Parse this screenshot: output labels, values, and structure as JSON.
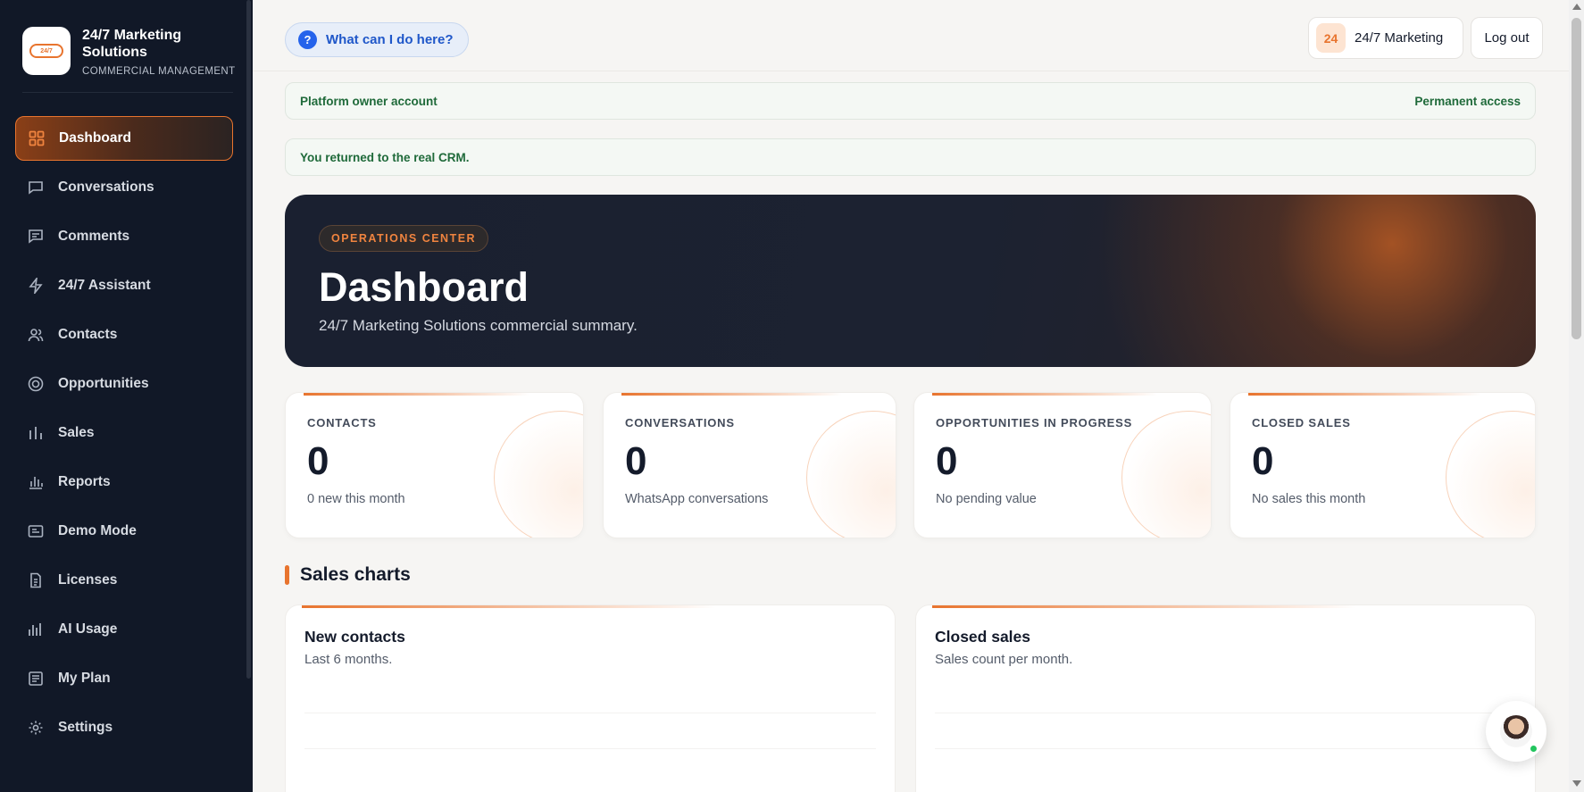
{
  "brand": {
    "name": "24/7 Marketing Solutions",
    "subtitle": "COMMERCIAL MANAGEMENT",
    "logo_text": "24/7"
  },
  "sidebar": {
    "items": [
      {
        "label": "Dashboard",
        "icon": "grid-icon",
        "active": true
      },
      {
        "label": "Conversations",
        "icon": "message-square-icon"
      },
      {
        "label": "Comments",
        "icon": "comment-lines-icon"
      },
      {
        "label": "24/7 Assistant",
        "icon": "zap-icon"
      },
      {
        "label": "Contacts",
        "icon": "users-icon"
      },
      {
        "label": "Opportunities",
        "icon": "target-icon"
      },
      {
        "label": "Sales",
        "icon": "bar-chart-icon"
      },
      {
        "label": "Reports",
        "icon": "report-chart-icon"
      },
      {
        "label": "Demo Mode",
        "icon": "demo-card-icon"
      },
      {
        "label": "Licenses",
        "icon": "license-document-icon"
      },
      {
        "label": "AI Usage",
        "icon": "usage-chart-icon"
      },
      {
        "label": "My Plan",
        "icon": "plan-document-icon"
      },
      {
        "label": "Settings",
        "icon": "gear-icon"
      }
    ]
  },
  "header": {
    "help_label": "What can I do here?",
    "help_icon": "?",
    "org_badge": "24",
    "org_name": "24/7 Marketing",
    "logout_label": "Log out"
  },
  "notices": {
    "owner_label": "Platform owner account",
    "owner_access": "Permanent access",
    "returned": "You returned to the real CRM."
  },
  "hero": {
    "eyebrow": "OPERATIONS CENTER",
    "title": "Dashboard",
    "subtitle": "24/7 Marketing Solutions commercial summary."
  },
  "stats": [
    {
      "label": "CONTACTS",
      "value": "0",
      "note": "0 new this month"
    },
    {
      "label": "CONVERSATIONS",
      "value": "0",
      "note": "WhatsApp conversations"
    },
    {
      "label": "OPPORTUNITIES IN PROGRESS",
      "value": "0",
      "note": "No pending value"
    },
    {
      "label": "CLOSED SALES",
      "value": "0",
      "note": "No sales this month"
    }
  ],
  "charts_section": {
    "title": "Sales charts",
    "cards": [
      {
        "title": "New contacts",
        "subtitle": "Last 6 months."
      },
      {
        "title": "Closed sales",
        "subtitle": "Sales count per month."
      }
    ]
  },
  "colors": {
    "accent": "#e8742e",
    "sidebar_bg": "#111827",
    "hero_bg": "#1a2030",
    "success_text": "#1f6a3a",
    "help_blue": "#2563eb"
  }
}
